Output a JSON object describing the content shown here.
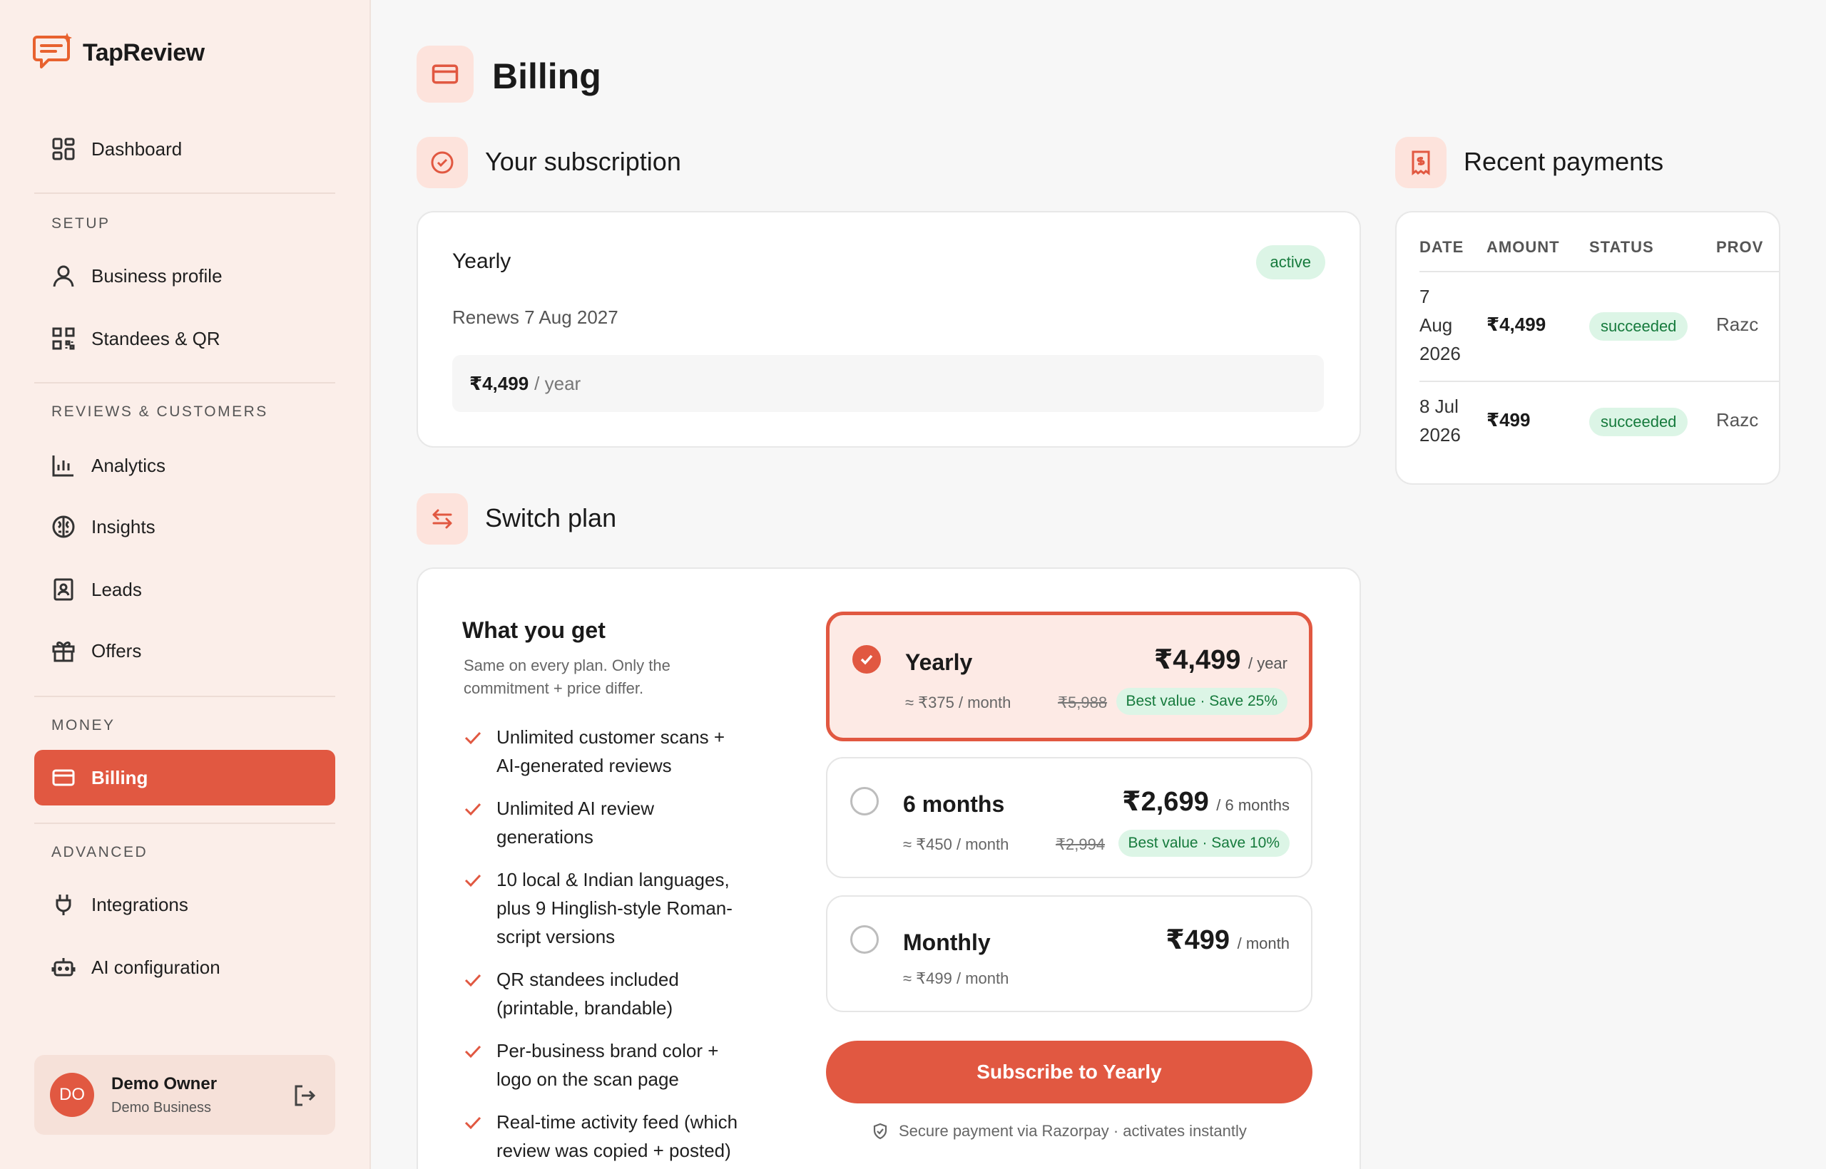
{
  "app": {
    "name": "TapReview",
    "brand_color": "#e15841"
  },
  "sidebar": {
    "dashboard": "Dashboard",
    "sections": {
      "setup": "SETUP",
      "reviews": "REVIEWS & CUSTOMERS",
      "money": "MONEY",
      "advanced": "ADVANCED"
    },
    "items": {
      "business_profile": "Business profile",
      "standees": "Standees & QR",
      "analytics": "Analytics",
      "insights": "Insights",
      "leads": "Leads",
      "offers": "Offers",
      "billing": "Billing",
      "integrations": "Integrations",
      "ai_config": "AI configuration"
    },
    "user": {
      "initials": "DO",
      "name": "Demo Owner",
      "business": "Demo Business"
    }
  },
  "page": {
    "title": "Billing"
  },
  "subscription": {
    "section_title": "Your subscription",
    "plan": "Yearly",
    "status": "active",
    "renews": "Renews 7 Aug 2027",
    "price": "₹4,499",
    "period": "/ year"
  },
  "payments": {
    "section_title": "Recent payments",
    "columns": [
      "DATE",
      "AMOUNT",
      "STATUS",
      "PROV"
    ],
    "rows": [
      {
        "date_l1": "7",
        "date_l2": "Aug",
        "date_l3": "2026",
        "amount": "₹4,499",
        "status": "succeeded",
        "provider": "Razc"
      },
      {
        "date_l1": "8 Jul",
        "date_l2": "2026",
        "amount": "₹499",
        "status": "succeeded",
        "provider": "Razc"
      }
    ]
  },
  "switch_plan": {
    "section_title": "Switch plan",
    "what_you_get": "What you get",
    "subtitle": "Same on every plan. Only the commitment + price differ.",
    "features": [
      [
        "Unlimited customer scans +",
        "AI-generated reviews"
      ],
      [
        "Unlimited AI review",
        "generations"
      ],
      [
        "10 local & Indian languages,",
        "plus 9 Hinglish-style Roman-",
        "script versions"
      ],
      [
        "QR standees included",
        "(printable, brandable)"
      ],
      [
        "Per-business brand color +",
        "logo on the scan page"
      ],
      [
        "Real-time activity feed (which",
        "review was copied + posted)"
      ]
    ],
    "plans": [
      {
        "name": "Yearly",
        "price": "₹4,499",
        "per": "/ year",
        "monthly": "≈ ₹375 / month",
        "old": "₹5,988",
        "save": "Best value · Save 25%",
        "selected": true
      },
      {
        "name": "6 months",
        "price": "₹2,699",
        "per": "/ 6 months",
        "monthly": "≈ ₹450 / month",
        "old": "₹2,994",
        "save": "Best value · Save 10%",
        "selected": false
      },
      {
        "name": "Monthly",
        "price": "₹499",
        "per": "/ month",
        "monthly": "≈ ₹499 / month",
        "selected": false
      }
    ],
    "subscribe_label": "Subscribe to Yearly",
    "secure_note": "Secure payment via Razorpay · activates instantly"
  }
}
